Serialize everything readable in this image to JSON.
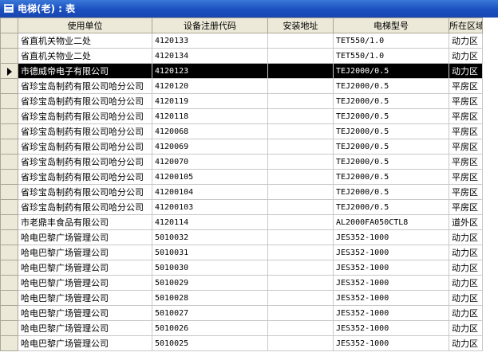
{
  "window": {
    "title": "电梯(老) : 表"
  },
  "columns": [
    "使用单位",
    "设备注册代码",
    "安装地址",
    "电梯型号",
    "所在区域"
  ],
  "current_row": 2,
  "rows": [
    [
      "省直机关物业二处",
      "4120133",
      "",
      "TET550/1.0",
      "动力区"
    ],
    [
      "省直机关物业二处",
      "4120134",
      "",
      "TET550/1.0",
      "动力区"
    ],
    [
      "市德威帝电子有限公司",
      "4120123",
      "",
      "TEJ2000/0.5",
      "动力区"
    ],
    [
      "省珍宝岛制药有限公司哈分公司",
      "4120120",
      "",
      "TEJ2000/0.5",
      "平房区"
    ],
    [
      "省珍宝岛制药有限公司哈分公司",
      "4120119",
      "",
      "TEJ2000/0.5",
      "平房区"
    ],
    [
      "省珍宝岛制药有限公司哈分公司",
      "4120118",
      "",
      "TEJ2000/0.5",
      "平房区"
    ],
    [
      "省珍宝岛制药有限公司哈分公司",
      "4120068",
      "",
      "TEJ2000/0.5",
      "平房区"
    ],
    [
      "省珍宝岛制药有限公司哈分公司",
      "4120069",
      "",
      "TEJ2000/0.5",
      "平房区"
    ],
    [
      "省珍宝岛制药有限公司哈分公司",
      "4120070",
      "",
      "TEJ2000/0.5",
      "平房区"
    ],
    [
      "省珍宝岛制药有限公司哈分公司",
      "41200105",
      "",
      "TEJ2000/0.5",
      "平房区"
    ],
    [
      "省珍宝岛制药有限公司哈分公司",
      "41200104",
      "",
      "TEJ2000/0.5",
      "平房区"
    ],
    [
      "省珍宝岛制药有限公司哈分公司",
      "41200103",
      "",
      "TEJ2000/0.5",
      "平房区"
    ],
    [
      "市老鼎丰食品有限公司",
      "4120114",
      "",
      "AL2000FA050CTL8",
      "道外区"
    ],
    [
      "哈电巴黎广场管理公司",
      "5010032",
      "",
      "JES352-1000",
      "动力区"
    ],
    [
      "哈电巴黎广场管理公司",
      "5010031",
      "",
      "JES352-1000",
      "动力区"
    ],
    [
      "哈电巴黎广场管理公司",
      "5010030",
      "",
      "JES352-1000",
      "动力区"
    ],
    [
      "哈电巴黎广场管理公司",
      "5010029",
      "",
      "JES352-1000",
      "动力区"
    ],
    [
      "哈电巴黎广场管理公司",
      "5010028",
      "",
      "JES352-1000",
      "动力区"
    ],
    [
      "哈电巴黎广场管理公司",
      "5010027",
      "",
      "JES352-1000",
      "动力区"
    ],
    [
      "哈电巴黎广场管理公司",
      "5010026",
      "",
      "JES352-1000",
      "动力区"
    ],
    [
      "哈电巴黎广场管理公司",
      "5010025",
      "",
      "JES352-1000",
      "动力区"
    ]
  ]
}
